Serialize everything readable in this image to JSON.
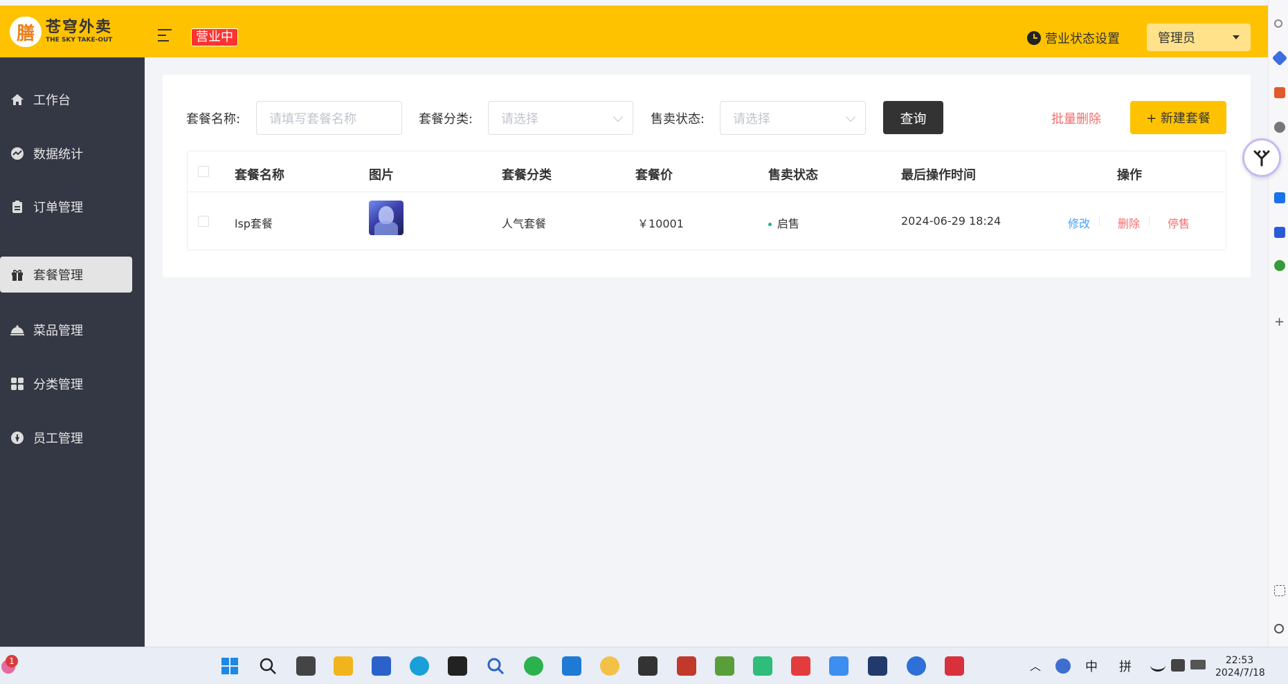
{
  "header": {
    "logo_cn": "苍穹外卖",
    "logo_en": "THE SKY TAKE-OUT",
    "business_status": "营业中",
    "status_setting_label": "营业状态设置",
    "user_menu_label": "管理员"
  },
  "sidebar": {
    "items": [
      {
        "label": "工作台",
        "icon": "home-icon"
      },
      {
        "label": "数据统计",
        "icon": "chart-icon"
      },
      {
        "label": "订单管理",
        "icon": "clipboard-icon"
      },
      {
        "label": "套餐管理",
        "icon": "gift-icon",
        "active": true
      },
      {
        "label": "菜品管理",
        "icon": "dish-cover-icon"
      },
      {
        "label": "分类管理",
        "icon": "grid-icon"
      },
      {
        "label": "员工管理",
        "icon": "employee-icon"
      }
    ]
  },
  "filters": {
    "name_label": "套餐名称:",
    "name_placeholder": "请填写套餐名称",
    "category_label": "套餐分类:",
    "category_placeholder": "请选择",
    "status_label": "售卖状态:",
    "status_placeholder": "请选择",
    "query_button": "查询",
    "batch_delete_button": "批量删除",
    "new_button": "+ 新建套餐"
  },
  "table": {
    "columns": [
      "套餐名称",
      "图片",
      "套餐分类",
      "套餐价",
      "售卖状态",
      "最后操作时间",
      "操作"
    ],
    "rows": [
      {
        "name": "lsp套餐",
        "category": "人气套餐",
        "price": "￥10001",
        "status": "启售",
        "updated": "2024-06-29 18:24",
        "actions": [
          "修改",
          "删除",
          "停售"
        ]
      }
    ]
  },
  "taskbar": {
    "notification_count": "1",
    "ime_lang": "中",
    "ime_mode": "拼",
    "time": "22:53",
    "date": "2024/7/18"
  },
  "colors": {
    "brand_yellow": "#ffc200",
    "sidebar_bg": "#343744",
    "danger": "#f56c6c",
    "link_blue": "#419eff",
    "on_sale_green": "#22b573"
  }
}
